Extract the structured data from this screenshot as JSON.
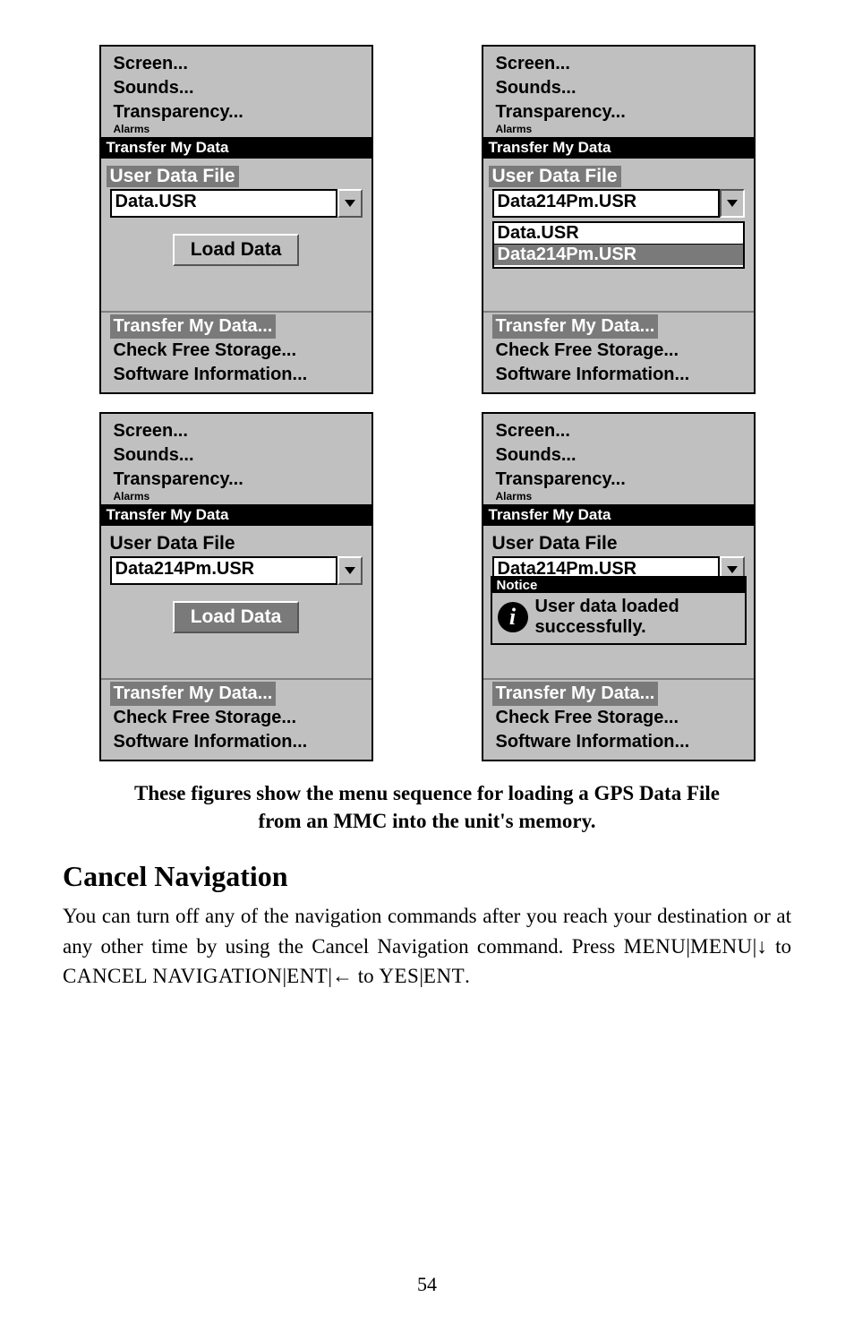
{
  "panels_top_menu": {
    "line1": "Screen...",
    "line2": "Sounds...",
    "line3": "Transparency...",
    "cut": "Alarms"
  },
  "dialog_title": "Transfer My Data",
  "field_label": "User Data File",
  "panel1": {
    "combo_value": "Data.USR",
    "button": "Load Data"
  },
  "panel2": {
    "combo_value": "Data214Pm.USR",
    "drop_item1": "Data.USR",
    "drop_item2": "Data214Pm.USR"
  },
  "panel3": {
    "combo_value": "Data214Pm.USR",
    "button": "Load Data"
  },
  "panel4": {
    "combo_value": "Data214Pm.USR",
    "notice_title": "Notice",
    "notice_text": "User data loaded successfully."
  },
  "bottom_menu": {
    "item1": "Transfer My Data...",
    "item2": "Check Free Storage...",
    "item3": "Software Information..."
  },
  "caption_line1": "These figures show the menu sequence for loading a GPS Data File",
  "caption_line2": "from an MMC into the unit's memory.",
  "section_heading": "Cancel Navigation",
  "body": {
    "p1a": "You can turn off any of the navigation commands after you reach your destination or at any other time by using the Cancel Navigation command. Press ",
    "menu1": "MENU",
    "bar": "|",
    "menu2": "MENU",
    "down": "↓",
    "to1": " to ",
    "cancel": "CANCEL NAVIGATION",
    "ent1": "ENT",
    "left": "←",
    "to2": " to ",
    "yes": "YES",
    "ent2": "ENT",
    "dot": "."
  },
  "page_number": "54"
}
